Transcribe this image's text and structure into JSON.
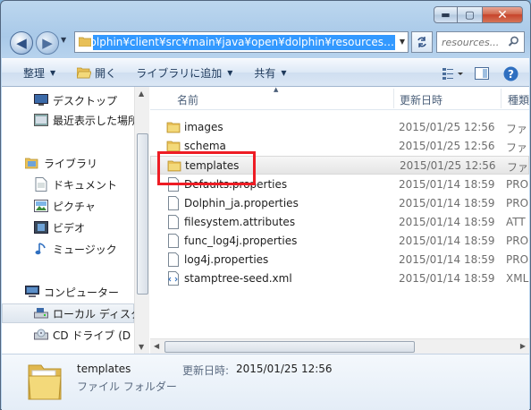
{
  "window": {
    "minimize_glyph": "▬",
    "maximize_glyph": "▢",
    "close_glyph": "✕"
  },
  "nav": {
    "back_glyph": "◀",
    "forward_glyph": "▶",
    "address": "…enDolphin¥client¥src¥main¥java¥open¥dolphin¥resources",
    "search_placeholder": "resources...",
    "refresh_icon": "refresh-icon"
  },
  "toolbar": {
    "organize": "整理",
    "open": "開く",
    "add_to_library": "ライブラリに追加",
    "share": "共有"
  },
  "sidebar": {
    "items": [
      {
        "label": "デスクトップ",
        "icon": "desktop-icon"
      },
      {
        "label": "最近表示した場所",
        "icon": "recent-places-icon"
      },
      {
        "label": "ライブラリ",
        "icon": "library-icon"
      },
      {
        "label": "ドキュメント",
        "icon": "documents-icon"
      },
      {
        "label": "ピクチャ",
        "icon": "pictures-icon"
      },
      {
        "label": "ビデオ",
        "icon": "videos-icon"
      },
      {
        "label": "ミュージック",
        "icon": "music-icon"
      },
      {
        "label": "コンピューター",
        "icon": "computer-icon"
      },
      {
        "label": "ローカル ディスク",
        "icon": "local-disk-icon"
      },
      {
        "label": "CD ドライブ (D",
        "icon": "cd-drive-icon"
      }
    ]
  },
  "columns": {
    "name": "名前",
    "date": "更新日時",
    "type": "種類"
  },
  "files": [
    {
      "name": "images",
      "date": "2015/01/25 12:56",
      "type": "ファ",
      "kind": "folder"
    },
    {
      "name": "schema",
      "date": "2015/01/25 12:56",
      "type": "ファ",
      "kind": "folder"
    },
    {
      "name": "templates",
      "date": "2015/01/25 12:56",
      "type": "ファ",
      "kind": "folder"
    },
    {
      "name": "Defaults.properties",
      "date": "2015/01/14 18:59",
      "type": "PRO",
      "kind": "file"
    },
    {
      "name": "Dolphin_ja.properties",
      "date": "2015/01/14 18:59",
      "type": "PRO",
      "kind": "file"
    },
    {
      "name": "filesystem.attributes",
      "date": "2015/01/14 18:59",
      "type": "ATT",
      "kind": "file"
    },
    {
      "name": "func_log4j.properties",
      "date": "2015/01/14 18:59",
      "type": "PRO",
      "kind": "file"
    },
    {
      "name": "log4j.properties",
      "date": "2015/01/14 18:59",
      "type": "PRO",
      "kind": "file"
    },
    {
      "name": "stamptree-seed.xml",
      "date": "2015/01/14 18:59",
      "type": "XML",
      "kind": "xml"
    }
  ],
  "details": {
    "name": "templates",
    "type": "ファイル フォルダー",
    "modified_label": "更新日時:",
    "modified_value": "2015/01/25 12:56"
  },
  "colors": {
    "highlight": "#ee1c24",
    "selection": "#3399ff",
    "folder": "#e8c058"
  }
}
